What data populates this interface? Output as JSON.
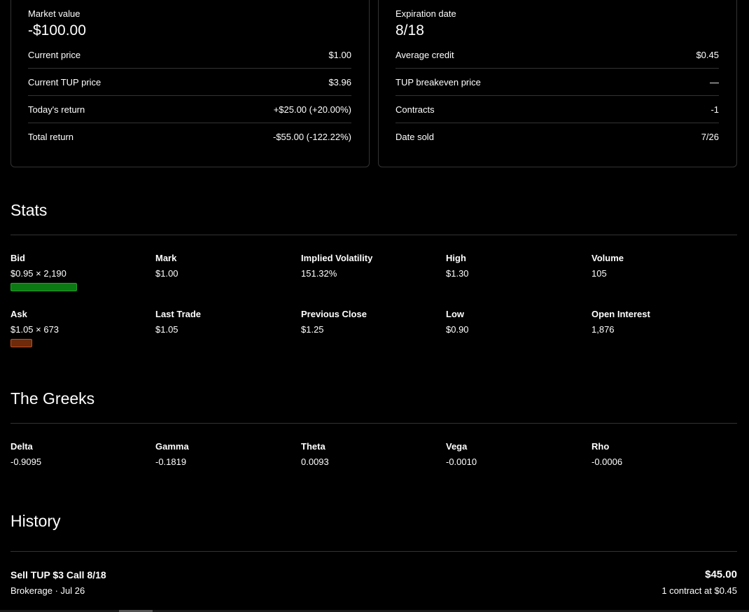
{
  "position_left": {
    "head_label": "Market value",
    "head_value": "-$100.00",
    "rows": [
      {
        "label": "Current price",
        "value": "$1.00"
      },
      {
        "label": "Current TUP price",
        "value": "$3.96"
      },
      {
        "label": "Today's return",
        "value": "+$25.00 (+20.00%)"
      },
      {
        "label": "Total return",
        "value": "-$55.00 (-122.22%)"
      }
    ]
  },
  "position_right": {
    "head_label": "Expiration date",
    "head_value": "8/18",
    "rows": [
      {
        "label": "Average credit",
        "value": "$0.45"
      },
      {
        "label": "TUP breakeven price",
        "value": "—"
      },
      {
        "label": "Contracts",
        "value": "-1"
      },
      {
        "label": "Date sold",
        "value": "7/26"
      }
    ]
  },
  "stats": {
    "title": "Stats",
    "items": [
      {
        "label": "Bid",
        "value": "$0.95 × 2,190"
      },
      {
        "label": "Mark",
        "value": "$1.00"
      },
      {
        "label": "Implied Volatility",
        "value": "151.32%"
      },
      {
        "label": "High",
        "value": "$1.30"
      },
      {
        "label": "Volume",
        "value": "105"
      },
      {
        "label": "Ask",
        "value": "$1.05 × 673"
      },
      {
        "label": "Last Trade",
        "value": "$1.05"
      },
      {
        "label": "Previous Close",
        "value": "$1.25"
      },
      {
        "label": "Low",
        "value": "$0.90"
      },
      {
        "label": "Open Interest",
        "value": "1,876"
      }
    ],
    "colors": {
      "bid_bar": "#0c7a12",
      "ask_bar": "#6e2a0a"
    }
  },
  "greeks": {
    "title": "The Greeks",
    "items": [
      {
        "label": "Delta",
        "value": "-0.9095"
      },
      {
        "label": "Gamma",
        "value": "-0.1819"
      },
      {
        "label": "Theta",
        "value": "0.0093"
      },
      {
        "label": "Vega",
        "value": "-0.0010"
      },
      {
        "label": "Rho",
        "value": "-0.0006"
      }
    ]
  },
  "history": {
    "title": "History",
    "entries": [
      {
        "title": "Sell TUP $3 Call 8/18",
        "sub": "Brokerage · Jul 26",
        "amount": "$45.00",
        "detail": "1 contract at $0.45"
      }
    ]
  }
}
